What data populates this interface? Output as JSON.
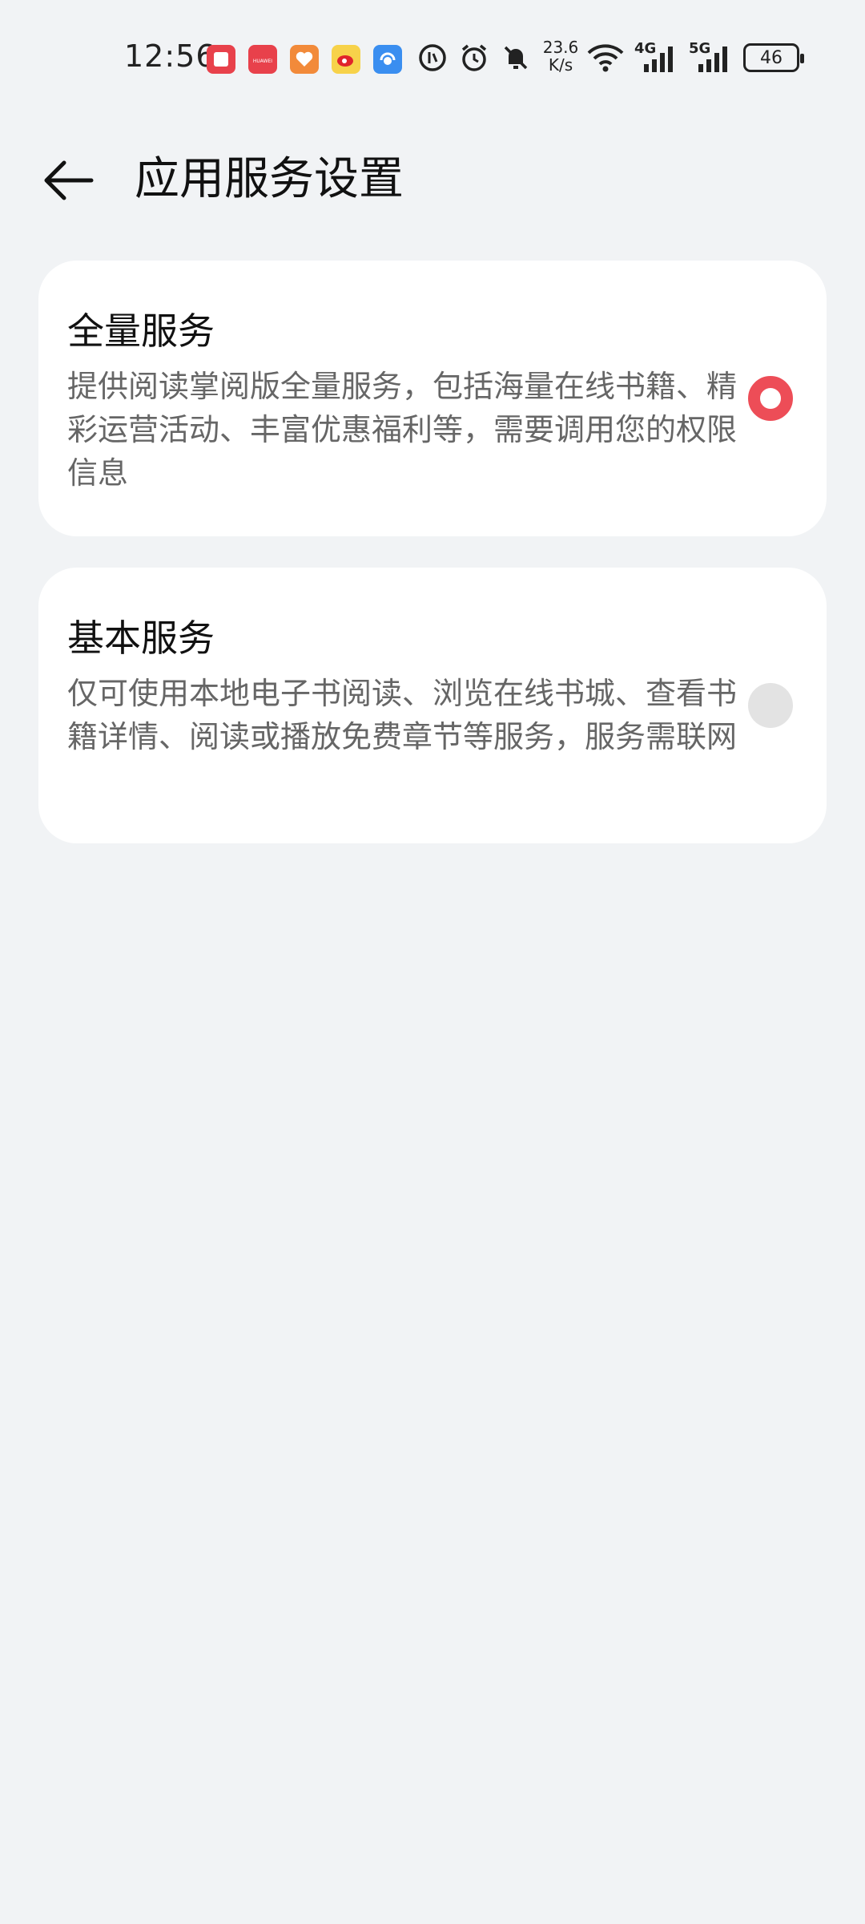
{
  "status_bar": {
    "time": "12:56",
    "net_speed_value": "23.6",
    "net_speed_unit": "K/s",
    "signal_1_label": "4G",
    "signal_2_label": "5G",
    "battery": "46",
    "icons": [
      "books-app-icon",
      "huawei-store-icon",
      "health-app-icon",
      "weibo-icon",
      "support-app-icon",
      "nfc-icon",
      "alarm-icon",
      "mute-icon",
      "wifi-icon",
      "signal-icon"
    ],
    "brand_label": "HUAWEI"
  },
  "header": {
    "title": "应用服务设置",
    "back_icon": "arrow-left-icon"
  },
  "options": [
    {
      "title": "全量服务",
      "description": "提供阅读掌阅版全量服务，包括海量在线书籍、精彩运营活动、丰富优惠福利等，需要调用您的权限信息",
      "selected": true
    },
    {
      "title": "基本服务",
      "description": "仅可使用本地电子书阅读、浏览在线书城、查看书籍详情、阅读或播放免费章节等服务，服务需联网",
      "selected": false
    }
  ],
  "colors": {
    "background": "#f1f3f5",
    "card": "#ffffff",
    "accent": "#ed4d57",
    "description_text": "#666666"
  }
}
